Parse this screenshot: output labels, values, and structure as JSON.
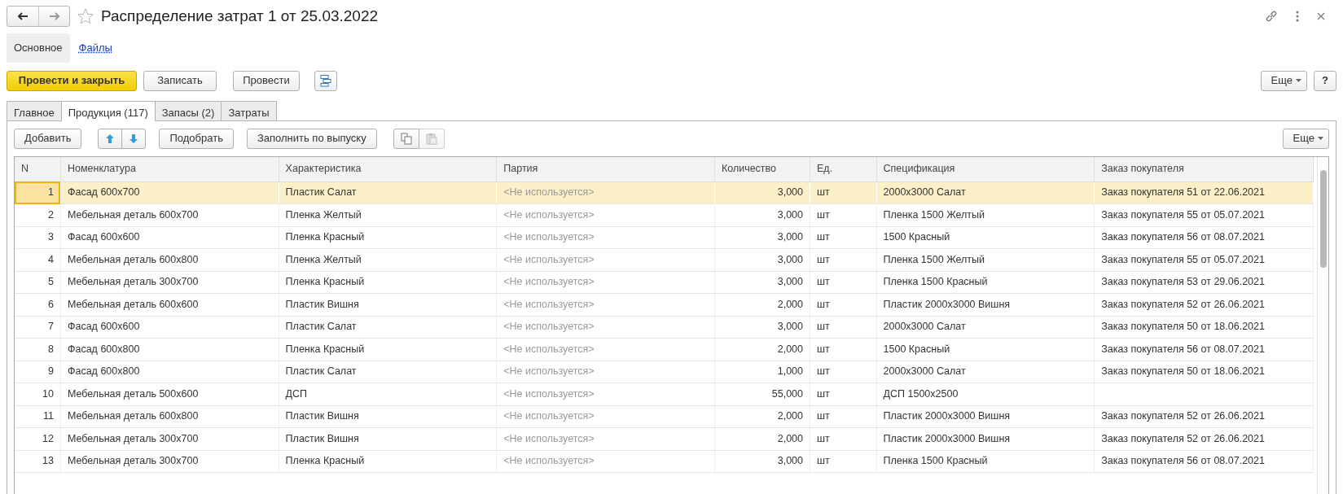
{
  "window": {
    "title": "Распределение затрат 1 от 25.03.2022",
    "starred": false
  },
  "sections": [
    {
      "label": "Основное",
      "selected": true
    },
    {
      "label": "Файлы",
      "selected": false
    }
  ],
  "command_bar": {
    "buttons": [
      {
        "kind": "primary",
        "label": "Провести и закрыть"
      },
      {
        "kind": "normal",
        "label": "Записать"
      },
      {
        "kind": "normal",
        "label": "Провести"
      },
      {
        "kind": "structure"
      }
    ],
    "more": "Еще",
    "help": "?"
  },
  "tabs": [
    {
      "label": "Главное",
      "selected": false
    },
    {
      "label": "Продукция (117)",
      "selected": true
    },
    {
      "label": "Запасы (2)",
      "selected": false
    },
    {
      "label": "Затраты",
      "selected": false
    }
  ],
  "table_toolbar": {
    "buttons": [
      {
        "kind": "text",
        "label": "Добавить",
        "disabled": false
      },
      {
        "kind": "up",
        "disabled": false
      },
      {
        "kind": "down",
        "disabled": false
      },
      {
        "kind": "text",
        "label": "Подобрать",
        "disabled": false
      },
      {
        "kind": "text",
        "label": "Заполнить по выпуску",
        "disabled": false
      },
      {
        "kind": "copy",
        "disabled": false
      },
      {
        "kind": "paste",
        "disabled": true
      }
    ],
    "more": "Еще"
  },
  "table": {
    "columns": [
      "N",
      "Номенклатура",
      "Характеристика",
      "Партия",
      "Количество",
      "Ед.",
      "Спецификация",
      "Заказ покупателя"
    ],
    "rows": [
      {
        "selected": true,
        "n": "1",
        "nomenclature": "Фасад 600x700",
        "characteristic": "Пластик Салат",
        "batch": "<Не используется>",
        "batch_used": false,
        "quantity": "3,000",
        "unit": "шт",
        "specification": "2000x3000 Салат",
        "order": "Заказ покупателя 51 от 22.06.2021"
      },
      {
        "selected": false,
        "n": "2",
        "nomenclature": "Мебельная деталь 600x700",
        "characteristic": "Пленка Желтый",
        "batch": "<Не используется>",
        "batch_used": false,
        "quantity": "3,000",
        "unit": "шт",
        "specification": "Пленка 1500 Желтый",
        "order": "Заказ покупателя 55 от 05.07.2021"
      },
      {
        "selected": false,
        "n": "3",
        "nomenclature": "Фасад 600x600",
        "characteristic": "Пленка Красный",
        "batch": "<Не используется>",
        "batch_used": false,
        "quantity": "3,000",
        "unit": "шт",
        "specification": "1500 Красный",
        "order": "Заказ покупателя 56 от 08.07.2021"
      },
      {
        "selected": false,
        "n": "4",
        "nomenclature": "Мебельная деталь 600x800",
        "characteristic": "Пленка Желтый",
        "batch": "<Не используется>",
        "batch_used": false,
        "quantity": "3,000",
        "unit": "шт",
        "specification": "Пленка 1500 Желтый",
        "order": "Заказ покупателя 55 от 05.07.2021"
      },
      {
        "selected": false,
        "n": "5",
        "nomenclature": "Мебельная деталь 300x700",
        "characteristic": "Пленка Красный",
        "batch": "<Не используется>",
        "batch_used": false,
        "quantity": "3,000",
        "unit": "шт",
        "specification": "Пленка 1500 Красный",
        "order": "Заказ покупателя 53 от 29.06.2021"
      },
      {
        "selected": false,
        "n": "6",
        "nomenclature": "Мебельная деталь 600x600",
        "characteristic": "Пластик Вишня",
        "batch": "<Не используется>",
        "batch_used": false,
        "quantity": "2,000",
        "unit": "шт",
        "specification": "Пластик 2000x3000 Вишня",
        "order": "Заказ покупателя 52 от 26.06.2021"
      },
      {
        "selected": false,
        "n": "7",
        "nomenclature": "Фасад 600x600",
        "characteristic": "Пластик Салат",
        "batch": "<Не используется>",
        "batch_used": false,
        "quantity": "3,000",
        "unit": "шт",
        "specification": "2000x3000 Салат",
        "order": "Заказ покупателя 50 от 18.06.2021"
      },
      {
        "selected": false,
        "n": "8",
        "nomenclature": "Фасад 600x800",
        "characteristic": "Пленка Красный",
        "batch": "<Не используется>",
        "batch_used": false,
        "quantity": "2,000",
        "unit": "шт",
        "specification": "1500 Красный",
        "order": "Заказ покупателя 56 от 08.07.2021"
      },
      {
        "selected": false,
        "n": "9",
        "nomenclature": "Фасад 600x800",
        "characteristic": "Пластик Салат",
        "batch": "<Не используется>",
        "batch_used": false,
        "quantity": "1,000",
        "unit": "шт",
        "specification": "2000x3000 Салат",
        "order": "Заказ покупателя 50 от 18.06.2021"
      },
      {
        "selected": false,
        "n": "10",
        "nomenclature": "Мебельная деталь 500x600",
        "characteristic": "ДСП",
        "batch": "<Не используется>",
        "batch_used": false,
        "quantity": "55,000",
        "unit": "шт",
        "specification": "ДСП 1500x2500"
      },
      {
        "selected": false,
        "n": "11",
        "nomenclature": "Мебельная деталь 600x800",
        "characteristic": "Пластик Вишня",
        "batch": "<Не используется>",
        "batch_used": false,
        "quantity": "2,000",
        "unit": "шт",
        "specification": "Пластик 2000x3000 Вишня",
        "order": "Заказ покупателя 52 от 26.06.2021"
      },
      {
        "selected": false,
        "n": "12",
        "nomenclature": "Мебельная деталь 300x700",
        "characteristic": "Пластик Вишня",
        "batch": "<Не используется>",
        "batch_used": false,
        "quantity": "2,000",
        "unit": "шт",
        "specification": "Пластик 2000x3000 Вишня",
        "order": "Заказ покупателя 52 от 26.06.2021"
      },
      {
        "selected": false,
        "n": "13",
        "nomenclature": "Мебельная деталь 300x700",
        "characteristic": "Пленка Красный",
        "batch": "<Не используется>",
        "batch_used": false,
        "quantity": "3,000",
        "unit": "шт",
        "specification": "Пленка 1500 Красный",
        "order": "Заказ покупателя 56 от 08.07.2021"
      }
    ]
  }
}
